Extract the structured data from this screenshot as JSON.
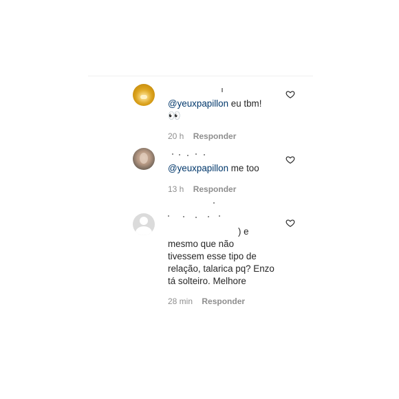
{
  "comments": [
    {
      "mention": "@yeuxpapillon",
      "text": " eu tbm!",
      "emoji": "👀",
      "time": "20 h",
      "reply_label": "Responder"
    },
    {
      "mention": "@yeuxpapillon",
      "text": " me too",
      "time": "13 h",
      "reply_label": "Responder"
    },
    {
      "fragment": ") e",
      "lines": [
        "mesmo que não",
        "tivessem esse tipo de",
        "relação, talarica pq? Enzo",
        "tá solteiro. Melhore"
      ],
      "time": "28 min",
      "reply_label": "Responder"
    }
  ],
  "icons": {
    "like": "heart-outline-icon"
  },
  "colors": {
    "mention": "#00376b",
    "muted": "#8e8e8e",
    "text": "#262626"
  }
}
